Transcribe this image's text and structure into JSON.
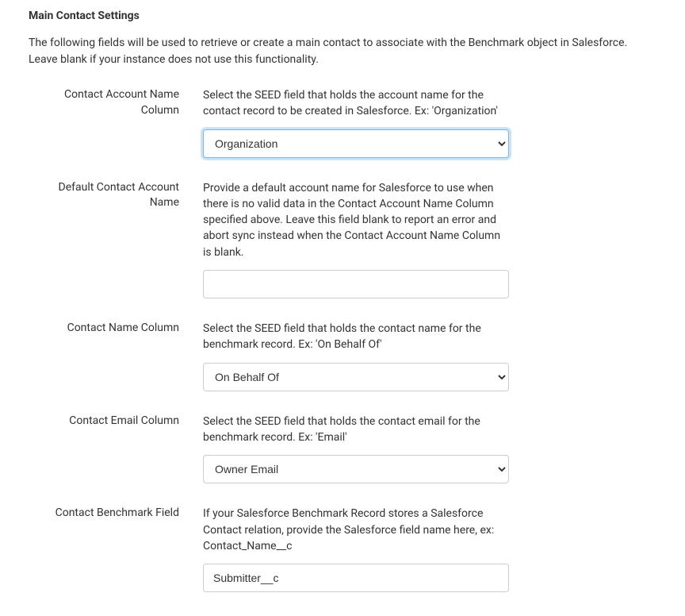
{
  "section": {
    "title": "Main Contact Settings",
    "desc": "The following fields will be used to retrieve or create a main contact to associate with the Benchmark object in Salesforce. Leave blank if your instance does not use this functionality."
  },
  "fields": {
    "accountNameCol": {
      "label": "Contact Account Name Column",
      "help": "Select the SEED field that holds the account name for the contact record to be created in Salesforce. Ex: 'Organization'",
      "value": "Organization"
    },
    "defaultAccountName": {
      "label": "Default Contact Account Name",
      "help": "Provide a default account name for Salesforce to use when there is no valid data in the Contact Account Name Column specified above. Leave this field blank to report an error and abort sync instead when the Contact Account Name Column is blank.",
      "value": ""
    },
    "contactNameCol": {
      "label": "Contact Name Column",
      "help": "Select the SEED field that holds the contact name for the benchmark record. Ex: 'On Behalf Of'",
      "value": "On Behalf Of"
    },
    "contactEmailCol": {
      "label": "Contact Email Column",
      "help": "Select the SEED field that holds the contact email for the benchmark record. Ex: 'Email'",
      "value": "Owner Email"
    },
    "benchmarkField": {
      "label": "Contact Benchmark Field",
      "help": "If your Salesforce Benchmark Record stores a Salesforce Contact relation, provide the Salesforce field name here, ex: Contact_Name__c",
      "value": "Submitter__c"
    }
  }
}
